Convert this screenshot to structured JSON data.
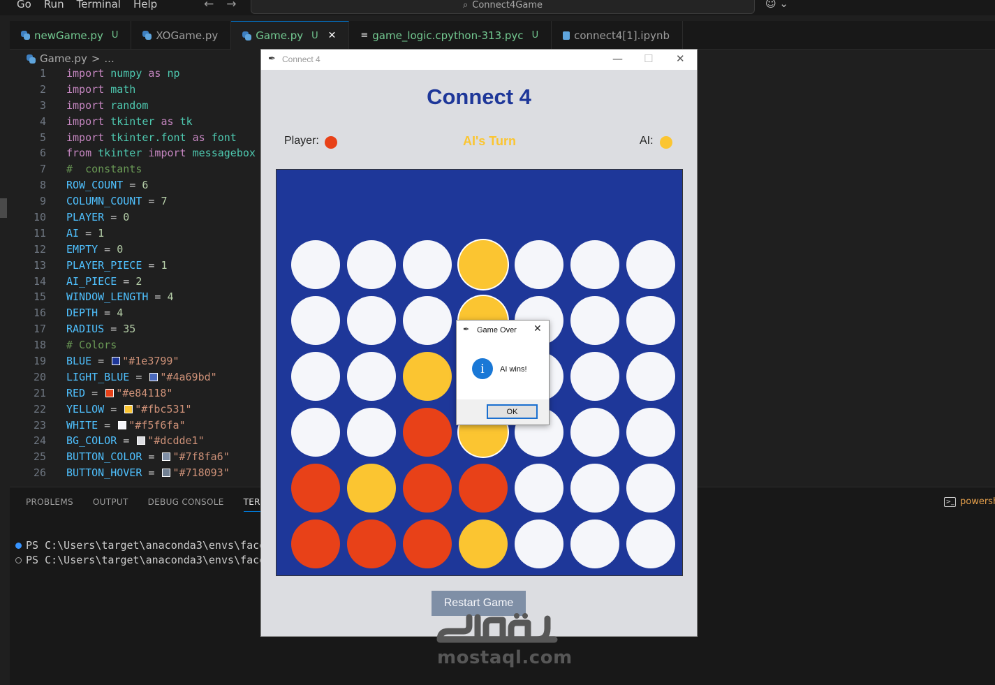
{
  "menu": [
    "Go",
    "Run",
    "Terminal",
    "Help"
  ],
  "command_center": "Connect4Game",
  "tabs": [
    {
      "label": "newGame.py",
      "badge": "U",
      "icon": "python-icon",
      "active": false
    },
    {
      "label": "XOGame.py",
      "badge": "",
      "icon": "python-icon",
      "active": false
    },
    {
      "label": "Game.py",
      "badge": "U",
      "icon": "python-icon",
      "active": true
    },
    {
      "label": "game_logic.cpython-313.pyc",
      "badge": "U",
      "icon": "file-lines-icon",
      "active": false
    },
    {
      "label": "connect4[1].ipynb",
      "badge": "",
      "icon": "notebook-icon",
      "active": false
    }
  ],
  "breadcrumb": {
    "file": "Game.py",
    "sep": ">",
    "rest": "..."
  },
  "code_lines": [
    {
      "n": "1",
      "html": "<span class='kw'>import</span> <span class='mod'>numpy</span> <span class='kw'>as</span> <span class='mod'>np</span>"
    },
    {
      "n": "2",
      "html": "<span class='kw'>import</span> <span class='mod'>math</span>"
    },
    {
      "n": "3",
      "html": "<span class='kw'>import</span> <span class='mod'>random</span>"
    },
    {
      "n": "4",
      "html": "<span class='kw'>import</span> <span class='mod'>tkinter</span> <span class='kw'>as</span> <span class='mod'>tk</span>"
    },
    {
      "n": "5",
      "html": "<span class='kw'>import</span> <span class='mod'>tkinter.font</span> <span class='kw'>as</span> <span class='mod'>font</span>"
    },
    {
      "n": "6",
      "html": "<span class='kw'>from</span> <span class='mod'>tkinter</span> <span class='kw'>import</span> <span class='mod'>messagebox</span>"
    },
    {
      "n": "7",
      "html": "<span class='cm'>#  constants</span>"
    },
    {
      "n": "8",
      "html": "<span class='const'>ROW_COUNT</span> = <span class='num'>6</span>"
    },
    {
      "n": "9",
      "html": "<span class='const'>COLUMN_COUNT</span> = <span class='num'>7</span>"
    },
    {
      "n": "10",
      "html": "<span class='const'>PLAYER</span> = <span class='num'>0</span>"
    },
    {
      "n": "11",
      "html": "<span class='const'>AI</span> = <span class='num'>1</span>"
    },
    {
      "n": "12",
      "html": "<span class='const'>EMPTY</span> = <span class='num'>0</span>"
    },
    {
      "n": "13",
      "html": "<span class='const'>PLAYER_PIECE</span> = <span class='num'>1</span>"
    },
    {
      "n": "14",
      "html": "<span class='const'>AI_PIECE</span> = <span class='num'>2</span>"
    },
    {
      "n": "15",
      "html": "<span class='const'>WINDOW_LENGTH</span> = <span class='num'>4</span>"
    },
    {
      "n": "16",
      "html": "<span class='const'>DEPTH</span> = <span class='num'>4</span>"
    },
    {
      "n": "17",
      "html": "<span class='const'>RADIUS</span> = <span class='num'>35</span>"
    },
    {
      "n": "18",
      "html": "<span class='cm'># Colors</span>"
    },
    {
      "n": "19",
      "html": "<span class='const'>BLUE</span> = <span class='sw' style='background:#1e3799'></span><span class='str'>\"#1e3799\"</span>"
    },
    {
      "n": "20",
      "html": "<span class='const'>LIGHT_BLUE</span> = <span class='sw' style='background:#4a69bd'></span><span class='str'>\"#4a69bd\"</span>"
    },
    {
      "n": "21",
      "html": "<span class='const'>RED</span> = <span class='sw' style='background:#e84118'></span><span class='str'>\"#e84118\"</span>"
    },
    {
      "n": "22",
      "html": "<span class='const'>YELLOW</span> = <span class='sw' style='background:#fbc531'></span><span class='str'>\"#fbc531\"</span>"
    },
    {
      "n": "23",
      "html": "<span class='const'>WHITE</span> = <span class='sw' style='background:#f5f6fa'></span><span class='str'>\"#f5f6fa\"</span>"
    },
    {
      "n": "24",
      "html": "<span class='const'>BG_COLOR</span> = <span class='sw' style='background:#dcdde1'></span><span class='str'>\"#dcdde1\"</span>"
    },
    {
      "n": "25",
      "html": "<span class='const'>BUTTON_COLOR</span> = <span class='sw' style='background:#7f8fa6'></span><span class='str'>\"#7f8fa6\"</span>"
    },
    {
      "n": "26",
      "html": "<span class='const'>BUTTON_HOVER</span> = <span class='sw' style='background:#718093'></span><span class='str'>\"#718093\"</span>"
    }
  ],
  "panel": {
    "tabs": [
      "PROBLEMS",
      "OUTPUT",
      "DEBUG CONSOLE",
      "TERM"
    ],
    "shell": "powersh",
    "terminal_lines": [
      "PS C:\\Users\\target\\anaconda3\\envs\\face",
      "PS C:\\Users\\target\\anaconda3\\envs\\face"
    ]
  },
  "game": {
    "window_title": "Connect 4",
    "title": "Connect 4",
    "player_label": "Player:",
    "turn_label": "AI's Turn",
    "ai_label": "AI:",
    "restart_label": "Restart Game",
    "colors": {
      "board": "#1e3799",
      "red": "#e84118",
      "yellow": "#fbc531",
      "empty": "#f5f6fa",
      "bg": "#dcdde1",
      "button": "#7f8fa6"
    },
    "grid": [
      [
        "E",
        "E",
        "E",
        "Y",
        "E",
        "E",
        "E"
      ],
      [
        "E",
        "E",
        "E",
        "Y",
        "E",
        "E",
        "E"
      ],
      [
        "E",
        "E",
        "Y",
        "Y",
        "E",
        "E",
        "E"
      ],
      [
        "E",
        "E",
        "R",
        "Y",
        "E",
        "E",
        "E"
      ],
      [
        "R",
        "Y",
        "R",
        "R",
        "E",
        "E",
        "E"
      ],
      [
        "R",
        "R",
        "R",
        "Y",
        "E",
        "E",
        "E"
      ]
    ],
    "winning_cells": [
      [
        0,
        3
      ],
      [
        1,
        3
      ],
      [
        2,
        3
      ],
      [
        3,
        3
      ]
    ]
  },
  "dialog": {
    "title": "Game Over",
    "message": "AI wins!",
    "ok_label": "OK",
    "icon": "info-icon"
  },
  "watermark": {
    "text": "mostaql.com"
  }
}
